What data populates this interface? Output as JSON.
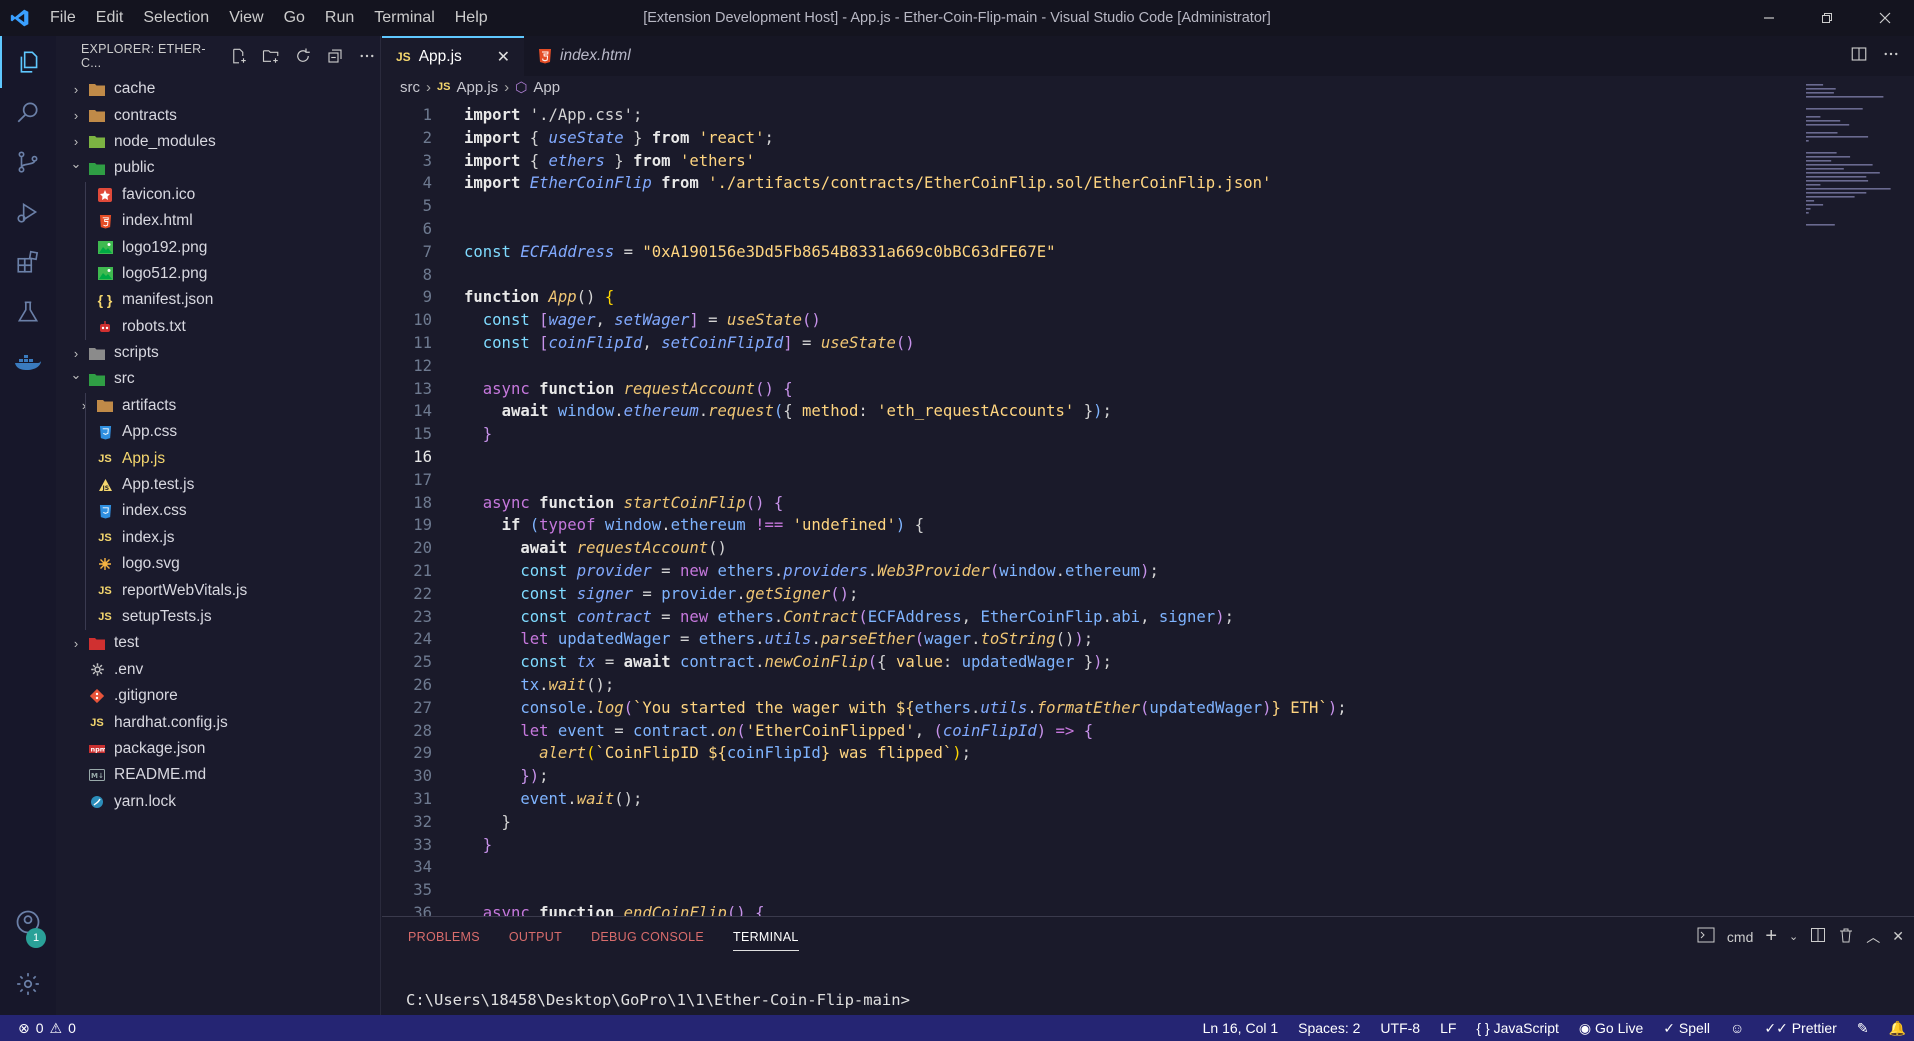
{
  "window": {
    "title": "[Extension Development Host] - App.js - Ether-Coin-Flip-main - Visual Studio Code [Administrator]"
  },
  "menu": [
    "File",
    "Edit",
    "Selection",
    "View",
    "Go",
    "Run",
    "Terminal",
    "Help"
  ],
  "activity_bar": {
    "items": [
      "explorer-icon",
      "search-icon",
      "source-control-icon",
      "run-debug-icon",
      "extensions-icon",
      "testing-icon",
      "docker-icon"
    ],
    "accounts_badge": "1"
  },
  "explorer": {
    "header": "EXPLORER: ETHER-C...",
    "tree": [
      {
        "label": "cache",
        "type": "folder",
        "depth": 0,
        "expanded": false
      },
      {
        "label": "contracts",
        "type": "folder",
        "depth": 0,
        "expanded": false
      },
      {
        "label": "node_modules",
        "type": "folder",
        "depth": 0,
        "expanded": false
      },
      {
        "label": "public",
        "type": "folder",
        "depth": 0,
        "expanded": true
      },
      {
        "label": "favicon.ico",
        "type": "file",
        "depth": 1,
        "icon": "favicon-icon"
      },
      {
        "label": "index.html",
        "type": "file",
        "depth": 1,
        "icon": "html-icon"
      },
      {
        "label": "logo192.png",
        "type": "file",
        "depth": 1,
        "icon": "image-icon"
      },
      {
        "label": "logo512.png",
        "type": "file",
        "depth": 1,
        "icon": "image-icon"
      },
      {
        "label": "manifest.json",
        "type": "file",
        "depth": 1,
        "icon": "json-icon"
      },
      {
        "label": "robots.txt",
        "type": "file",
        "depth": 1,
        "icon": "robot-icon"
      },
      {
        "label": "scripts",
        "type": "folder",
        "depth": 0,
        "expanded": false
      },
      {
        "label": "src",
        "type": "folder",
        "depth": 0,
        "expanded": true
      },
      {
        "label": "artifacts",
        "type": "folder",
        "depth": 1,
        "expanded": false
      },
      {
        "label": "App.css",
        "type": "file",
        "depth": 1,
        "icon": "css-icon"
      },
      {
        "label": "App.js",
        "type": "file",
        "depth": 1,
        "icon": "js-icon",
        "selected": true
      },
      {
        "label": "App.test.js",
        "type": "file",
        "depth": 1,
        "icon": "test-js-icon"
      },
      {
        "label": "index.css",
        "type": "file",
        "depth": 1,
        "icon": "css-icon"
      },
      {
        "label": "index.js",
        "type": "file",
        "depth": 1,
        "icon": "js-icon"
      },
      {
        "label": "logo.svg",
        "type": "file",
        "depth": 1,
        "icon": "svg-icon"
      },
      {
        "label": "reportWebVitals.js",
        "type": "file",
        "depth": 1,
        "icon": "js-icon"
      },
      {
        "label": "setupTests.js",
        "type": "file",
        "depth": 1,
        "icon": "js-icon"
      },
      {
        "label": "test",
        "type": "folder",
        "depth": 0,
        "expanded": false
      },
      {
        "label": ".env",
        "type": "file",
        "depth": 0,
        "icon": "gear-icon"
      },
      {
        "label": ".gitignore",
        "type": "file",
        "depth": 0,
        "icon": "git-icon"
      },
      {
        "label": "hardhat.config.js",
        "type": "file",
        "depth": 0,
        "icon": "js-icon"
      },
      {
        "label": "package.json",
        "type": "file",
        "depth": 0,
        "icon": "npm-icon"
      },
      {
        "label": "README.md",
        "type": "file",
        "depth": 0,
        "icon": "markdown-icon"
      },
      {
        "label": "yarn.lock",
        "type": "file",
        "depth": 0,
        "icon": "yarn-icon"
      }
    ]
  },
  "tabs": [
    {
      "label": "App.js",
      "icon": "JS",
      "active": true
    },
    {
      "label": "index.html",
      "icon": "html-icon",
      "active": false
    }
  ],
  "breadcrumb": {
    "folder": "src",
    "file": "App.js",
    "symbol": "App"
  },
  "editor": {
    "current_line": 16,
    "lines": [
      [
        [
          "k",
          "import "
        ],
        [
          "pu",
          "'./App.css';"
        ]
      ],
      [
        [
          "k",
          "import "
        ],
        [
          "pu",
          "{ "
        ],
        [
          "va",
          "useState"
        ],
        [
          "pu",
          " } "
        ],
        [
          "k",
          "from "
        ],
        [
          "st",
          "'react'"
        ],
        [
          "pu",
          ";"
        ]
      ],
      [
        [
          "k",
          "import "
        ],
        [
          "pu",
          "{ "
        ],
        [
          "va",
          "ethers"
        ],
        [
          "pu",
          " } "
        ],
        [
          "k",
          "from "
        ],
        [
          "st",
          "'ethers'"
        ]
      ],
      [
        [
          "k",
          "import "
        ],
        [
          "va",
          "EtherCoinFlip"
        ],
        [
          "k",
          " from "
        ],
        [
          "st",
          "'./artifacts/contracts/EtherCoinFlip.sol/EtherCoinFlip.json'"
        ]
      ],
      [],
      [],
      [
        [
          "cn",
          "const "
        ],
        [
          "va",
          "ECFAddress"
        ],
        [
          "pu",
          " = "
        ],
        [
          "st",
          "\"0xA190156e3Dd5Fb8654B8331a669c0bBC63dFE67E\""
        ]
      ],
      [],
      [
        [
          "k",
          "function "
        ],
        [
          "fn",
          "App"
        ],
        [
          "pu",
          "() "
        ],
        [
          "br",
          "{"
        ]
      ],
      [
        [
          "pu",
          "  "
        ],
        [
          "cn",
          "const "
        ],
        [
          "vb",
          "["
        ],
        [
          "va",
          "wager"
        ],
        [
          "pu",
          ", "
        ],
        [
          "va",
          "setWager"
        ],
        [
          "vb",
          "]"
        ],
        [
          "pu",
          " = "
        ],
        [
          "fn",
          "useState"
        ],
        [
          "vb",
          "()"
        ]
      ],
      [
        [
          "pu",
          "  "
        ],
        [
          "cn",
          "const "
        ],
        [
          "vb",
          "["
        ],
        [
          "va",
          "coinFlipId"
        ],
        [
          "pu",
          ", "
        ],
        [
          "va",
          "setCoinFlipId"
        ],
        [
          "vb",
          "]"
        ],
        [
          "pu",
          " = "
        ],
        [
          "fn",
          "useState"
        ],
        [
          "vb",
          "()"
        ]
      ],
      [],
      [
        [
          "pu",
          "  "
        ],
        [
          "kw",
          "async "
        ],
        [
          "k",
          "function "
        ],
        [
          "fn",
          "requestAccount"
        ],
        [
          "vb",
          "() {"
        ]
      ],
      [
        [
          "pu",
          "    "
        ],
        [
          "k",
          "await "
        ],
        [
          "ob",
          "window"
        ],
        [
          "pu",
          "."
        ],
        [
          "va",
          "ethereum"
        ],
        [
          "pu",
          "."
        ],
        [
          "fn",
          "request"
        ],
        [
          "ob",
          "("
        ],
        [
          "pu",
          "{ "
        ],
        [
          "st",
          "method"
        ],
        [
          "pu",
          ": "
        ],
        [
          "st",
          "'eth_requestAccounts'"
        ],
        [
          "pu",
          " }"
        ],
        [
          "ob",
          ")"
        ],
        [
          "pu",
          ";"
        ]
      ],
      [
        [
          "pu",
          "  "
        ],
        [
          "vb",
          "}"
        ]
      ],
      [],
      [],
      [
        [
          "pu",
          "  "
        ],
        [
          "kw",
          "async "
        ],
        [
          "k",
          "function "
        ],
        [
          "fn",
          "startCoinFlip"
        ],
        [
          "vb",
          "() {"
        ]
      ],
      [
        [
          "pu",
          "    "
        ],
        [
          "k",
          "if "
        ],
        [
          "ob",
          "("
        ],
        [
          "kw",
          "typeof "
        ],
        [
          "ob",
          "window"
        ],
        [
          "pu",
          "."
        ],
        [
          "ob",
          "ethereum"
        ],
        [
          "kw",
          " !== "
        ],
        [
          "st",
          "'undefined'"
        ],
        [
          "ob",
          ")"
        ],
        [
          "pu",
          " {"
        ]
      ],
      [
        [
          "pu",
          "      "
        ],
        [
          "k",
          "await "
        ],
        [
          "fn",
          "requestAccount"
        ],
        [
          "pu",
          "()"
        ]
      ],
      [
        [
          "pu",
          "      "
        ],
        [
          "cn",
          "const "
        ],
        [
          "va",
          "provider"
        ],
        [
          "pu",
          " = "
        ],
        [
          "kw",
          "new "
        ],
        [
          "ob",
          "ethers"
        ],
        [
          "pu",
          "."
        ],
        [
          "va",
          "providers"
        ],
        [
          "pu",
          "."
        ],
        [
          "fn",
          "Web3Provider"
        ],
        [
          "vb",
          "("
        ],
        [
          "ob",
          "window"
        ],
        [
          "pu",
          "."
        ],
        [
          "ob",
          "ethereum"
        ],
        [
          "vb",
          ")"
        ],
        [
          "pu",
          ";"
        ]
      ],
      [
        [
          "pu",
          "      "
        ],
        [
          "cn",
          "const "
        ],
        [
          "va",
          "signer"
        ],
        [
          "pu",
          " = "
        ],
        [
          "ob",
          "provider"
        ],
        [
          "pu",
          "."
        ],
        [
          "fn",
          "getSigner"
        ],
        [
          "vb",
          "()"
        ],
        [
          "pu",
          ";"
        ]
      ],
      [
        [
          "pu",
          "      "
        ],
        [
          "cn",
          "const "
        ],
        [
          "va",
          "contract"
        ],
        [
          "pu",
          " = "
        ],
        [
          "kw",
          "new "
        ],
        [
          "ob",
          "ethers"
        ],
        [
          "pu",
          "."
        ],
        [
          "fn",
          "Contract"
        ],
        [
          "vb",
          "("
        ],
        [
          "ob",
          "ECFAddress"
        ],
        [
          "pu",
          ", "
        ],
        [
          "ob",
          "EtherCoinFlip"
        ],
        [
          "pu",
          "."
        ],
        [
          "ob",
          "abi"
        ],
        [
          "pu",
          ", "
        ],
        [
          "ob",
          "signer"
        ],
        [
          "vb",
          ")"
        ],
        [
          "pu",
          ";"
        ]
      ],
      [
        [
          "pu",
          "      "
        ],
        [
          "kw",
          "let "
        ],
        [
          "ob",
          "updatedWager"
        ],
        [
          "pu",
          " = "
        ],
        [
          "ob",
          "ethers"
        ],
        [
          "pu",
          "."
        ],
        [
          "va",
          "utils"
        ],
        [
          "pu",
          "."
        ],
        [
          "fn",
          "parseEther"
        ],
        [
          "vb",
          "("
        ],
        [
          "ob",
          "wager"
        ],
        [
          "pu",
          "."
        ],
        [
          "fn",
          "toString"
        ],
        [
          "pu",
          "()"
        ],
        [
          "vb",
          ")"
        ],
        [
          "pu",
          ";"
        ]
      ],
      [
        [
          "pu",
          "      "
        ],
        [
          "cn",
          "const "
        ],
        [
          "va",
          "tx"
        ],
        [
          "pu",
          " = "
        ],
        [
          "k",
          "await "
        ],
        [
          "ob",
          "contract"
        ],
        [
          "pu",
          "."
        ],
        [
          "fn",
          "newCoinFlip"
        ],
        [
          "vb",
          "("
        ],
        [
          "pu",
          "{ "
        ],
        [
          "st",
          "value"
        ],
        [
          "pu",
          ": "
        ],
        [
          "ob",
          "updatedWager"
        ],
        [
          "pu",
          " }"
        ],
        [
          "vb",
          ")"
        ],
        [
          "pu",
          ";"
        ]
      ],
      [
        [
          "pu",
          "      "
        ],
        [
          "ob",
          "tx"
        ],
        [
          "pu",
          "."
        ],
        [
          "fn",
          "wait"
        ],
        [
          "pu",
          "();"
        ]
      ],
      [
        [
          "pu",
          "      "
        ],
        [
          "ob",
          "console"
        ],
        [
          "pu",
          "."
        ],
        [
          "fn",
          "log"
        ],
        [
          "vb",
          "("
        ],
        [
          "st",
          "`You started the wager with ${"
        ],
        [
          "ob",
          "ethers"
        ],
        [
          "pu",
          "."
        ],
        [
          "va",
          "utils"
        ],
        [
          "pu",
          "."
        ],
        [
          "fn",
          "formatEther"
        ],
        [
          "vb",
          "("
        ],
        [
          "ob",
          "updatedWager"
        ],
        [
          "vb",
          ")"
        ],
        [
          "st",
          "} ETH`"
        ],
        [
          "vb",
          ")"
        ],
        [
          "pu",
          ";"
        ]
      ],
      [
        [
          "pu",
          "      "
        ],
        [
          "kw",
          "let "
        ],
        [
          "ob",
          "event"
        ],
        [
          "pu",
          " = "
        ],
        [
          "ob",
          "contract"
        ],
        [
          "pu",
          "."
        ],
        [
          "fn",
          "on"
        ],
        [
          "vb",
          "("
        ],
        [
          "st",
          "'EtherCoinFlipped'"
        ],
        [
          "pu",
          ", "
        ],
        [
          "vb",
          "("
        ],
        [
          "va",
          "coinFlipId"
        ],
        [
          "vb",
          ")"
        ],
        [
          "kw",
          " => "
        ],
        [
          "vb",
          "{"
        ]
      ],
      [
        [
          "pu",
          "        "
        ],
        [
          "fn",
          "alert"
        ],
        [
          "br",
          "("
        ],
        [
          "st",
          "`CoinFlipID ${"
        ],
        [
          "ob",
          "coinFlipId"
        ],
        [
          "st",
          "} was flipped`"
        ],
        [
          "br",
          ")"
        ],
        [
          "pu",
          ";"
        ]
      ],
      [
        [
          "pu",
          "      "
        ],
        [
          "vb",
          "})"
        ],
        [
          "pu",
          ";"
        ]
      ],
      [
        [
          "pu",
          "      "
        ],
        [
          "ob",
          "event"
        ],
        [
          "pu",
          "."
        ],
        [
          "fn",
          "wait"
        ],
        [
          "pu",
          "();"
        ]
      ],
      [
        [
          "pu",
          "    }"
        ]
      ],
      [
        [
          "pu",
          "  "
        ],
        [
          "vb",
          "}"
        ]
      ],
      [],
      [],
      [
        [
          "pu",
          "  "
        ],
        [
          "kw",
          "async "
        ],
        [
          "k",
          "function "
        ],
        [
          "fn",
          "endCoinFlip"
        ],
        [
          "vb",
          "() {"
        ]
      ]
    ]
  },
  "panel": {
    "tabs": [
      "PROBLEMS",
      "OUTPUT",
      "DEBUG CONSOLE",
      "TERMINAL"
    ],
    "active_tab": "TERMINAL",
    "shell": "cmd",
    "prompt": "C:\\Users\\18458\\Desktop\\GoPro\\1\\1\\Ether-Coin-Flip-main>"
  },
  "statusbar": {
    "errors": "0",
    "warnings": "0",
    "position": "Ln 16, Col 1",
    "spaces": "Spaces: 2",
    "encoding": "UTF-8",
    "eol": "LF",
    "language": "JavaScript",
    "golive": "Go Live",
    "spell": "Spell",
    "prettier": "Prettier"
  },
  "colors": {
    "accent": "#5fc8ff",
    "statusbar_bg": "#252573",
    "background": "#1a1a2a"
  }
}
